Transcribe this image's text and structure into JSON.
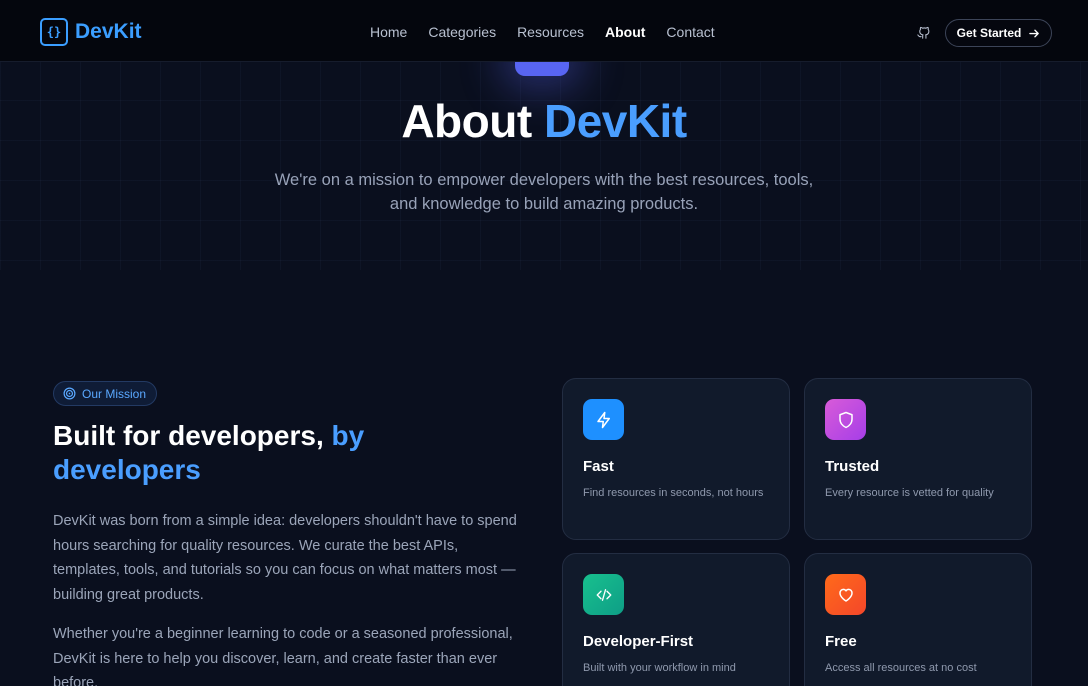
{
  "brand": {
    "logo_glyph": "{}",
    "name": "DevKit",
    "color": "#3b9eff"
  },
  "nav": {
    "items": [
      {
        "label": "Home",
        "active": false
      },
      {
        "label": "Categories",
        "active": false
      },
      {
        "label": "Resources",
        "active": false
      },
      {
        "label": "About",
        "active": true
      },
      {
        "label": "Contact",
        "active": false
      }
    ],
    "github_icon": "github-icon",
    "cta_label": "Get Started",
    "cta_icon": "arrow-right-icon"
  },
  "hero": {
    "title_main": "About",
    "title_accent": "DevKit",
    "subtitle_line1": "We're on a mission to empower developers with the best resources, tools,",
    "subtitle_line2": "and knowledge to build amazing products."
  },
  "mission": {
    "badge_icon": "target-icon",
    "badge_label": "Our Mission",
    "heading_main": "Built for developers,",
    "heading_accent": "by developers",
    "paragraph1": "DevKit was born from a simple idea: developers shouldn't have to spend hours searching for quality resources. We curate the best APIs, templates, tools, and tutorials so you can focus on what matters most — building great products.",
    "paragraph2": "Whether you're a beginner learning to code or a seasoned professional, DevKit is here to help you discover, learn, and create faster than ever before."
  },
  "features": [
    {
      "title": "Fast",
      "description": "Find resources in seconds, not hours",
      "icon": "lightning-icon",
      "color": "#1e90ff"
    },
    {
      "title": "Trusted",
      "description": "Every resource is vetted for quality",
      "icon": "shield-icon",
      "color": "#c94be0"
    },
    {
      "title": "Developer-First",
      "description": "Built with your workflow in mind",
      "icon": "code-icon",
      "color": "#12b48a"
    },
    {
      "title": "Free",
      "description": "Access all resources at no cost",
      "icon": "heart-icon",
      "color": "#ff5a1f"
    }
  ],
  "colors": {
    "background": "#0a0f1e",
    "accent": "#4a9eff",
    "card": "#111a2b"
  }
}
